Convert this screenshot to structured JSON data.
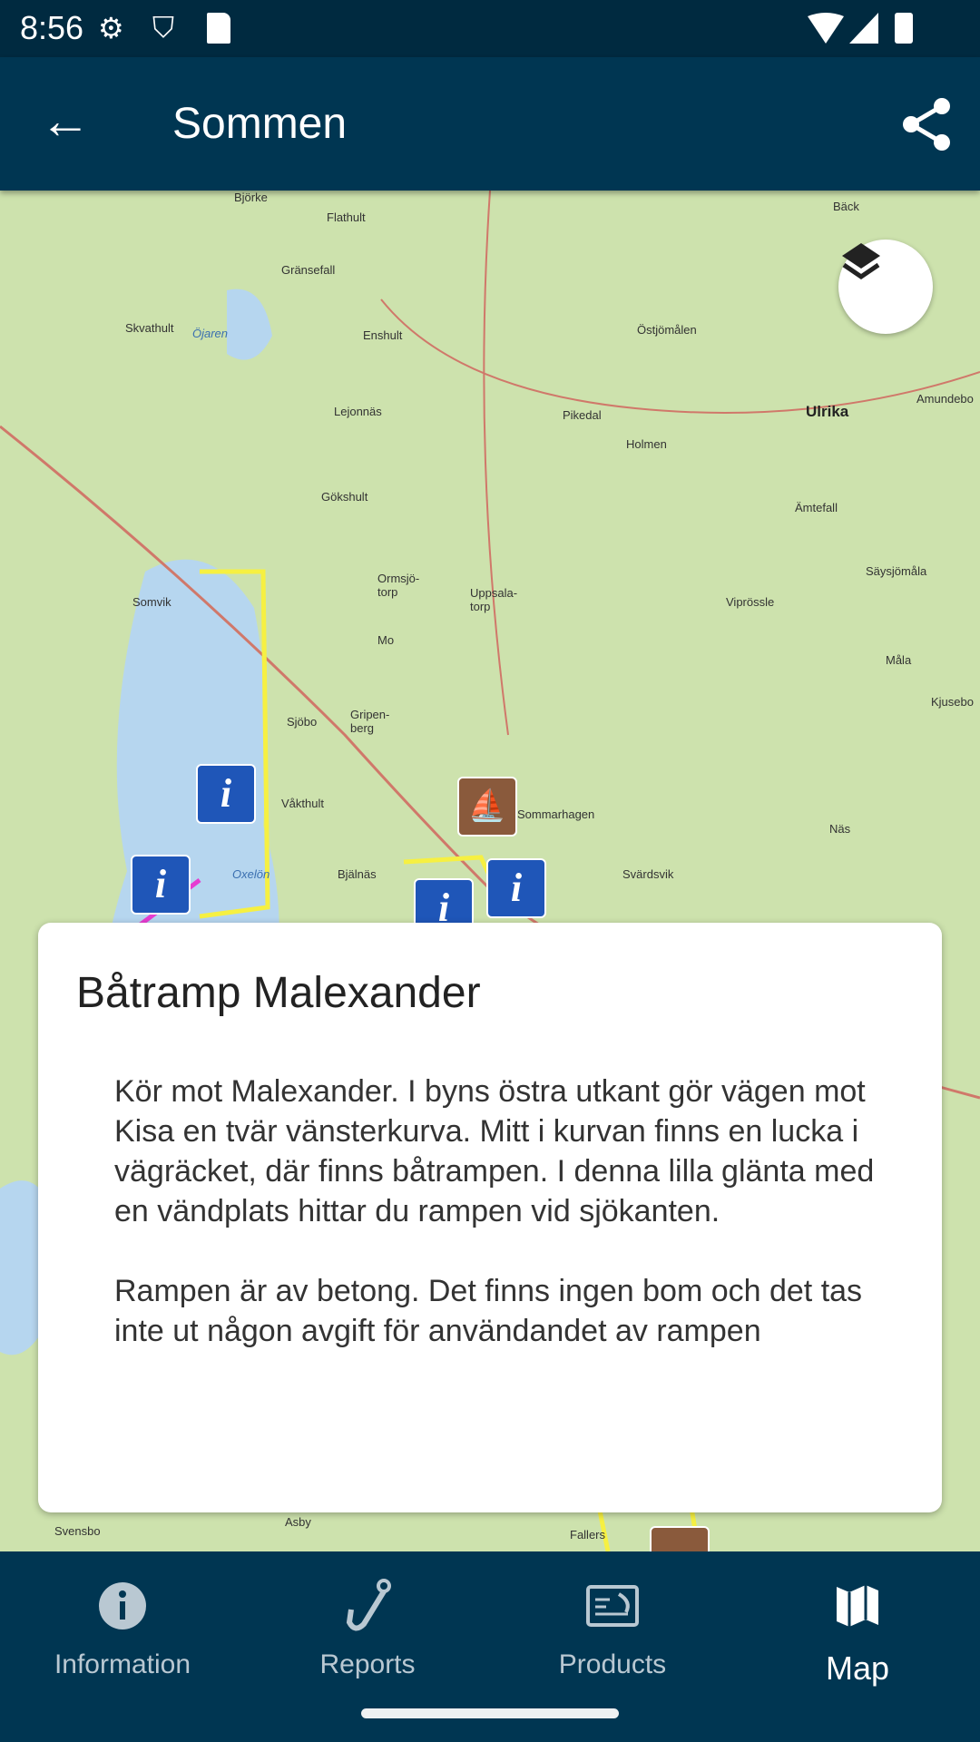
{
  "status": {
    "time": "8:56",
    "icons": [
      "gear-icon",
      "shield-play-icon",
      "sd-card-icon",
      "wifi-icon",
      "signal-icon",
      "battery-icon"
    ]
  },
  "toolbar": {
    "title": "Sommen",
    "back_icon": "arrow-left-icon",
    "share_icon": "share-icon"
  },
  "map": {
    "layers_icon": "layers-icon",
    "labels": [
      "Björke",
      "Flathult",
      "Gränsefall",
      "Skvathult",
      "Öjaren",
      "Enshult",
      "Lejonnäs",
      "Gökshult",
      "Pikedal",
      "Holmen",
      "Östjömålen",
      "Ulrika",
      "Amundebo",
      "Ämtefall",
      "Säysjömåla",
      "Ormsjö-torp",
      "Uppsala-torp",
      "Somvik",
      "Mo",
      "Viprössle",
      "Måla",
      "Kjusebo",
      "Sjöbo",
      "Gripen-berg",
      "Våkthult",
      "Sommarhagen",
      "Näs",
      "Bjälnäs",
      "Svärdsvik",
      "Oxelön",
      "Bäck",
      "Asby",
      "Svensbo",
      "Fallers"
    ]
  },
  "card": {
    "title": "Båtramp Malexander",
    "paragraphs": [
      "Kör mot Malexander. I byns östra utkant gör vägen mot Kisa en tvär vänsterkurva. Mitt i kurvan finns en lucka i vägräcket, där finns båtrampen. I denna lilla glänta med en vändplats hittar du rampen vid sjökanten.",
      "Rampen är av betong. Det finns ingen bom och det tas inte ut någon avgift för användandet av rampen"
    ]
  },
  "nav": {
    "tabs": [
      {
        "label": "Information",
        "icon": "info-icon"
      },
      {
        "label": "Reports",
        "icon": "fishing-hook-icon"
      },
      {
        "label": "Products",
        "icon": "fishing-license-icon"
      },
      {
        "label": "Map",
        "icon": "map-icon",
        "active": true
      }
    ]
  },
  "colors": {
    "primary": "#003652",
    "status_bar": "#002a40",
    "poi_info": "#1f56b8",
    "poi_ramp": "#8a5a3c"
  }
}
